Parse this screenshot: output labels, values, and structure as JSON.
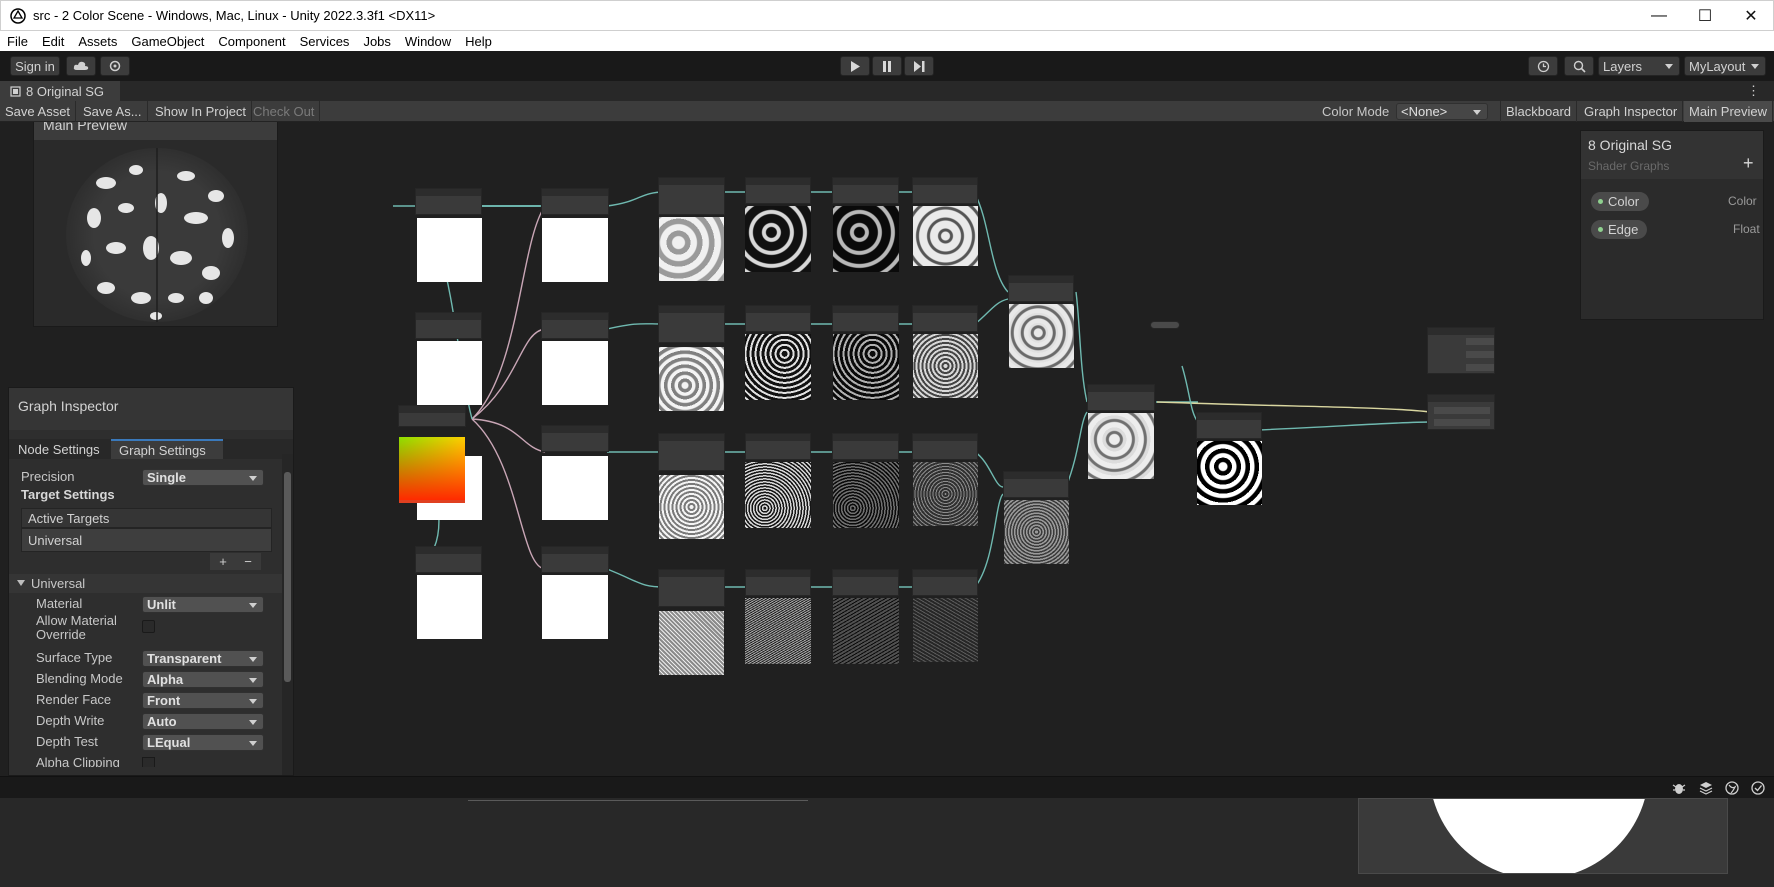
{
  "window": {
    "title": "src - 2 Color Scene - Windows, Mac, Linux - Unity 2022.3.3f1 <DX11>",
    "minimize": "—",
    "maximize": "☐",
    "close": "✕"
  },
  "menu": [
    "File",
    "Edit",
    "Assets",
    "GameObject",
    "Component",
    "Services",
    "Jobs",
    "Window",
    "Help"
  ],
  "toolbar": {
    "sign_in": "Sign in",
    "layers": "Layers",
    "layout": "MyLayout"
  },
  "tab": {
    "title": "8 Original SG"
  },
  "sg_toolbar": {
    "save_asset": "Save Asset",
    "save_as": "Save As...",
    "show_in_project": "Show In Project",
    "check_out": "Check Out",
    "color_mode_label": "Color Mode",
    "color_mode_value": "<None>",
    "blackboard": "Blackboard",
    "graph_inspector": "Graph Inspector",
    "main_preview": "Main Preview"
  },
  "main_preview": {
    "title": "Main Preview"
  },
  "blackboard": {
    "title": "8 Original SG",
    "subtitle": "Shader Graphs",
    "add": "+",
    "properties": [
      {
        "name": "Color",
        "type": "Color"
      },
      {
        "name": "Edge",
        "type": "Float"
      }
    ]
  },
  "inspector": {
    "title": "Graph Inspector",
    "tabs": [
      "Node Settings",
      "Graph Settings"
    ],
    "precision_label": "Precision",
    "precision_value": "Single",
    "target_settings": "Target Settings",
    "active_targets": "Active Targets",
    "target_item": "Universal",
    "add": "+",
    "remove": "−",
    "section": "Universal",
    "fields": [
      {
        "label": "Material",
        "value": "Unlit"
      },
      {
        "label": "Allow Material Override",
        "value": ""
      },
      {
        "label": "Surface Type",
        "value": "Transparent"
      },
      {
        "label": "Blending Mode",
        "value": "Alpha"
      },
      {
        "label": "Render Face",
        "value": "Front"
      },
      {
        "label": "Depth Write",
        "value": "Auto"
      },
      {
        "label": "Depth Test",
        "value": "LEqual"
      },
      {
        "label": "Alpha Clipping",
        "value": ""
      }
    ]
  },
  "icons": {
    "unity": "unity-logo-icon",
    "cloud": "cloud-icon",
    "settings": "collab-icon",
    "play": "play-icon",
    "pause": "pause-icon",
    "step": "step-icon",
    "history": "history-icon",
    "search": "search-icon",
    "bug": "bug-icon",
    "layers": "layers-icon",
    "globe": "globe-icon",
    "check": "check-icon"
  },
  "colors": {
    "accent_green": "#8fd08f",
    "wire_teal": "#6fb9b0",
    "wire_pink": "#c9a6b6",
    "wire_yellow": "#d9d6a0"
  }
}
